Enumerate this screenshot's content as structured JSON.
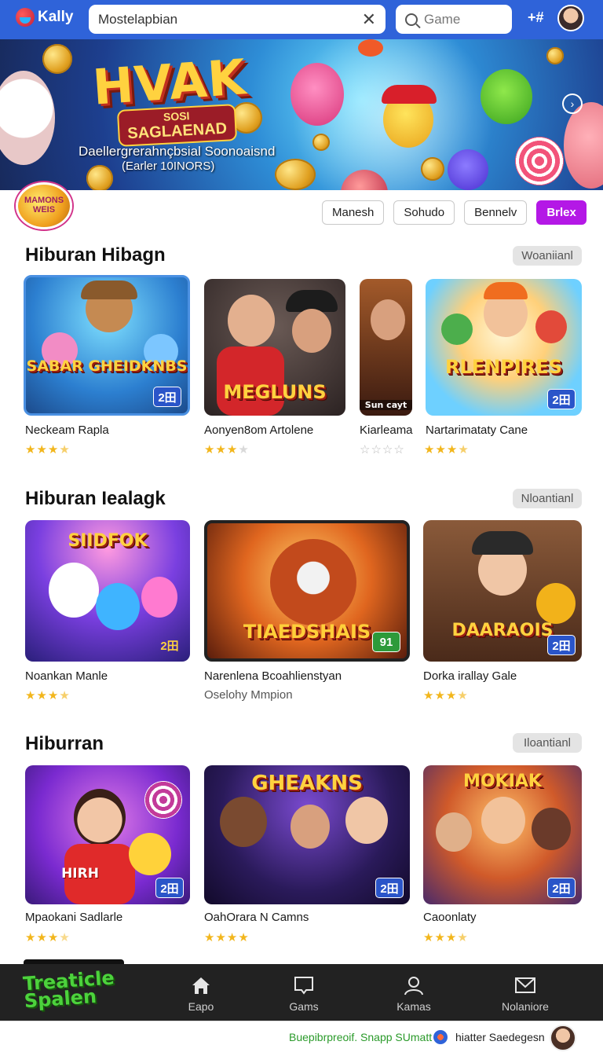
{
  "header": {
    "logo_text": "Kally",
    "search_value": "Mostelapbian",
    "game_search_placeholder": "Game",
    "notif_text": "+#"
  },
  "hero": {
    "title": "HVAK",
    "subtitle_line1": "SOSI",
    "subtitle_line2": "SAGLAENAD",
    "text1": "Daellergrerahnçbsial Soonoaisnd",
    "text2": "(Earler 10INORS)"
  },
  "filter_row": {
    "badge_text": "MAMONS WEIS",
    "chips": [
      "Manesh",
      "Sohudo",
      "Bennelv",
      "Brlex"
    ]
  },
  "sections": [
    {
      "title": "Hiburan Hibagn",
      "more_label": "Woaniianl",
      "cards": [
        {
          "thumb_text": "SABAR GHEIDKNBS",
          "badge": "2田",
          "title": "Neckeam Rapla",
          "rating": 4.5
        },
        {
          "thumb_text": "MEGLUNS",
          "badge": "",
          "title": "Aonyen8om Artolene",
          "rating": 3.5
        },
        {
          "thumb_text": "Sun cayt",
          "badge": "",
          "title": "Kiarleama",
          "rating": 0
        },
        {
          "thumb_text": "RLENPIRES",
          "badge": "2田",
          "title": "Nartarimataty Cane",
          "rating": 4.5
        }
      ]
    },
    {
      "title": "Hiburan Iealagk",
      "more_label": "Nloantianl",
      "cards": [
        {
          "thumb_text": "SIIDFOK",
          "badge": "2田",
          "title": "Noankan Manle",
          "rating": 4.5
        },
        {
          "thumb_text": "TIAEDSHAIS",
          "badge": "91",
          "title": "Narenlena Bcoahlienstyan",
          "subtitle": "Oselohy Mmpion",
          "rating": null
        },
        {
          "thumb_text": "DAARAOIS",
          "badge": "2田",
          "title": "Dorka irallay Gale",
          "rating": 4.5
        }
      ]
    },
    {
      "title": "Hiburran",
      "more_label": "Iloantianl",
      "cards": [
        {
          "thumb_text": "HIRH",
          "badge": "2田",
          "title": "Mpaokani Sadlarle",
          "rating": 3.5
        },
        {
          "thumb_text": "GHEAKNS",
          "badge": "2田",
          "title": "OahOrara N Camns",
          "rating": 5
        },
        {
          "thumb_text": "MOKIAK",
          "badge": "2田",
          "title": "Caoonlaty",
          "rating": 4.5
        }
      ]
    }
  ],
  "bottom_nav": {
    "logo_text": "Treaticle Spalen",
    "items": [
      {
        "label": "Eapo",
        "icon": "home-icon"
      },
      {
        "label": "Gams",
        "icon": "book-icon"
      },
      {
        "label": "Kamas",
        "icon": "user-icon"
      },
      {
        "label": "Nolaniore",
        "icon": "mail-icon"
      }
    ],
    "promo_text": "Buepibrpreoif. Snapp SUmatt",
    "user_text": "hiatter Saedegesn"
  },
  "colors": {
    "brand_blue": "#2f63d9",
    "active_chip": "#b418e6",
    "star": "#f2b61c",
    "nav_bg": "#222222"
  }
}
